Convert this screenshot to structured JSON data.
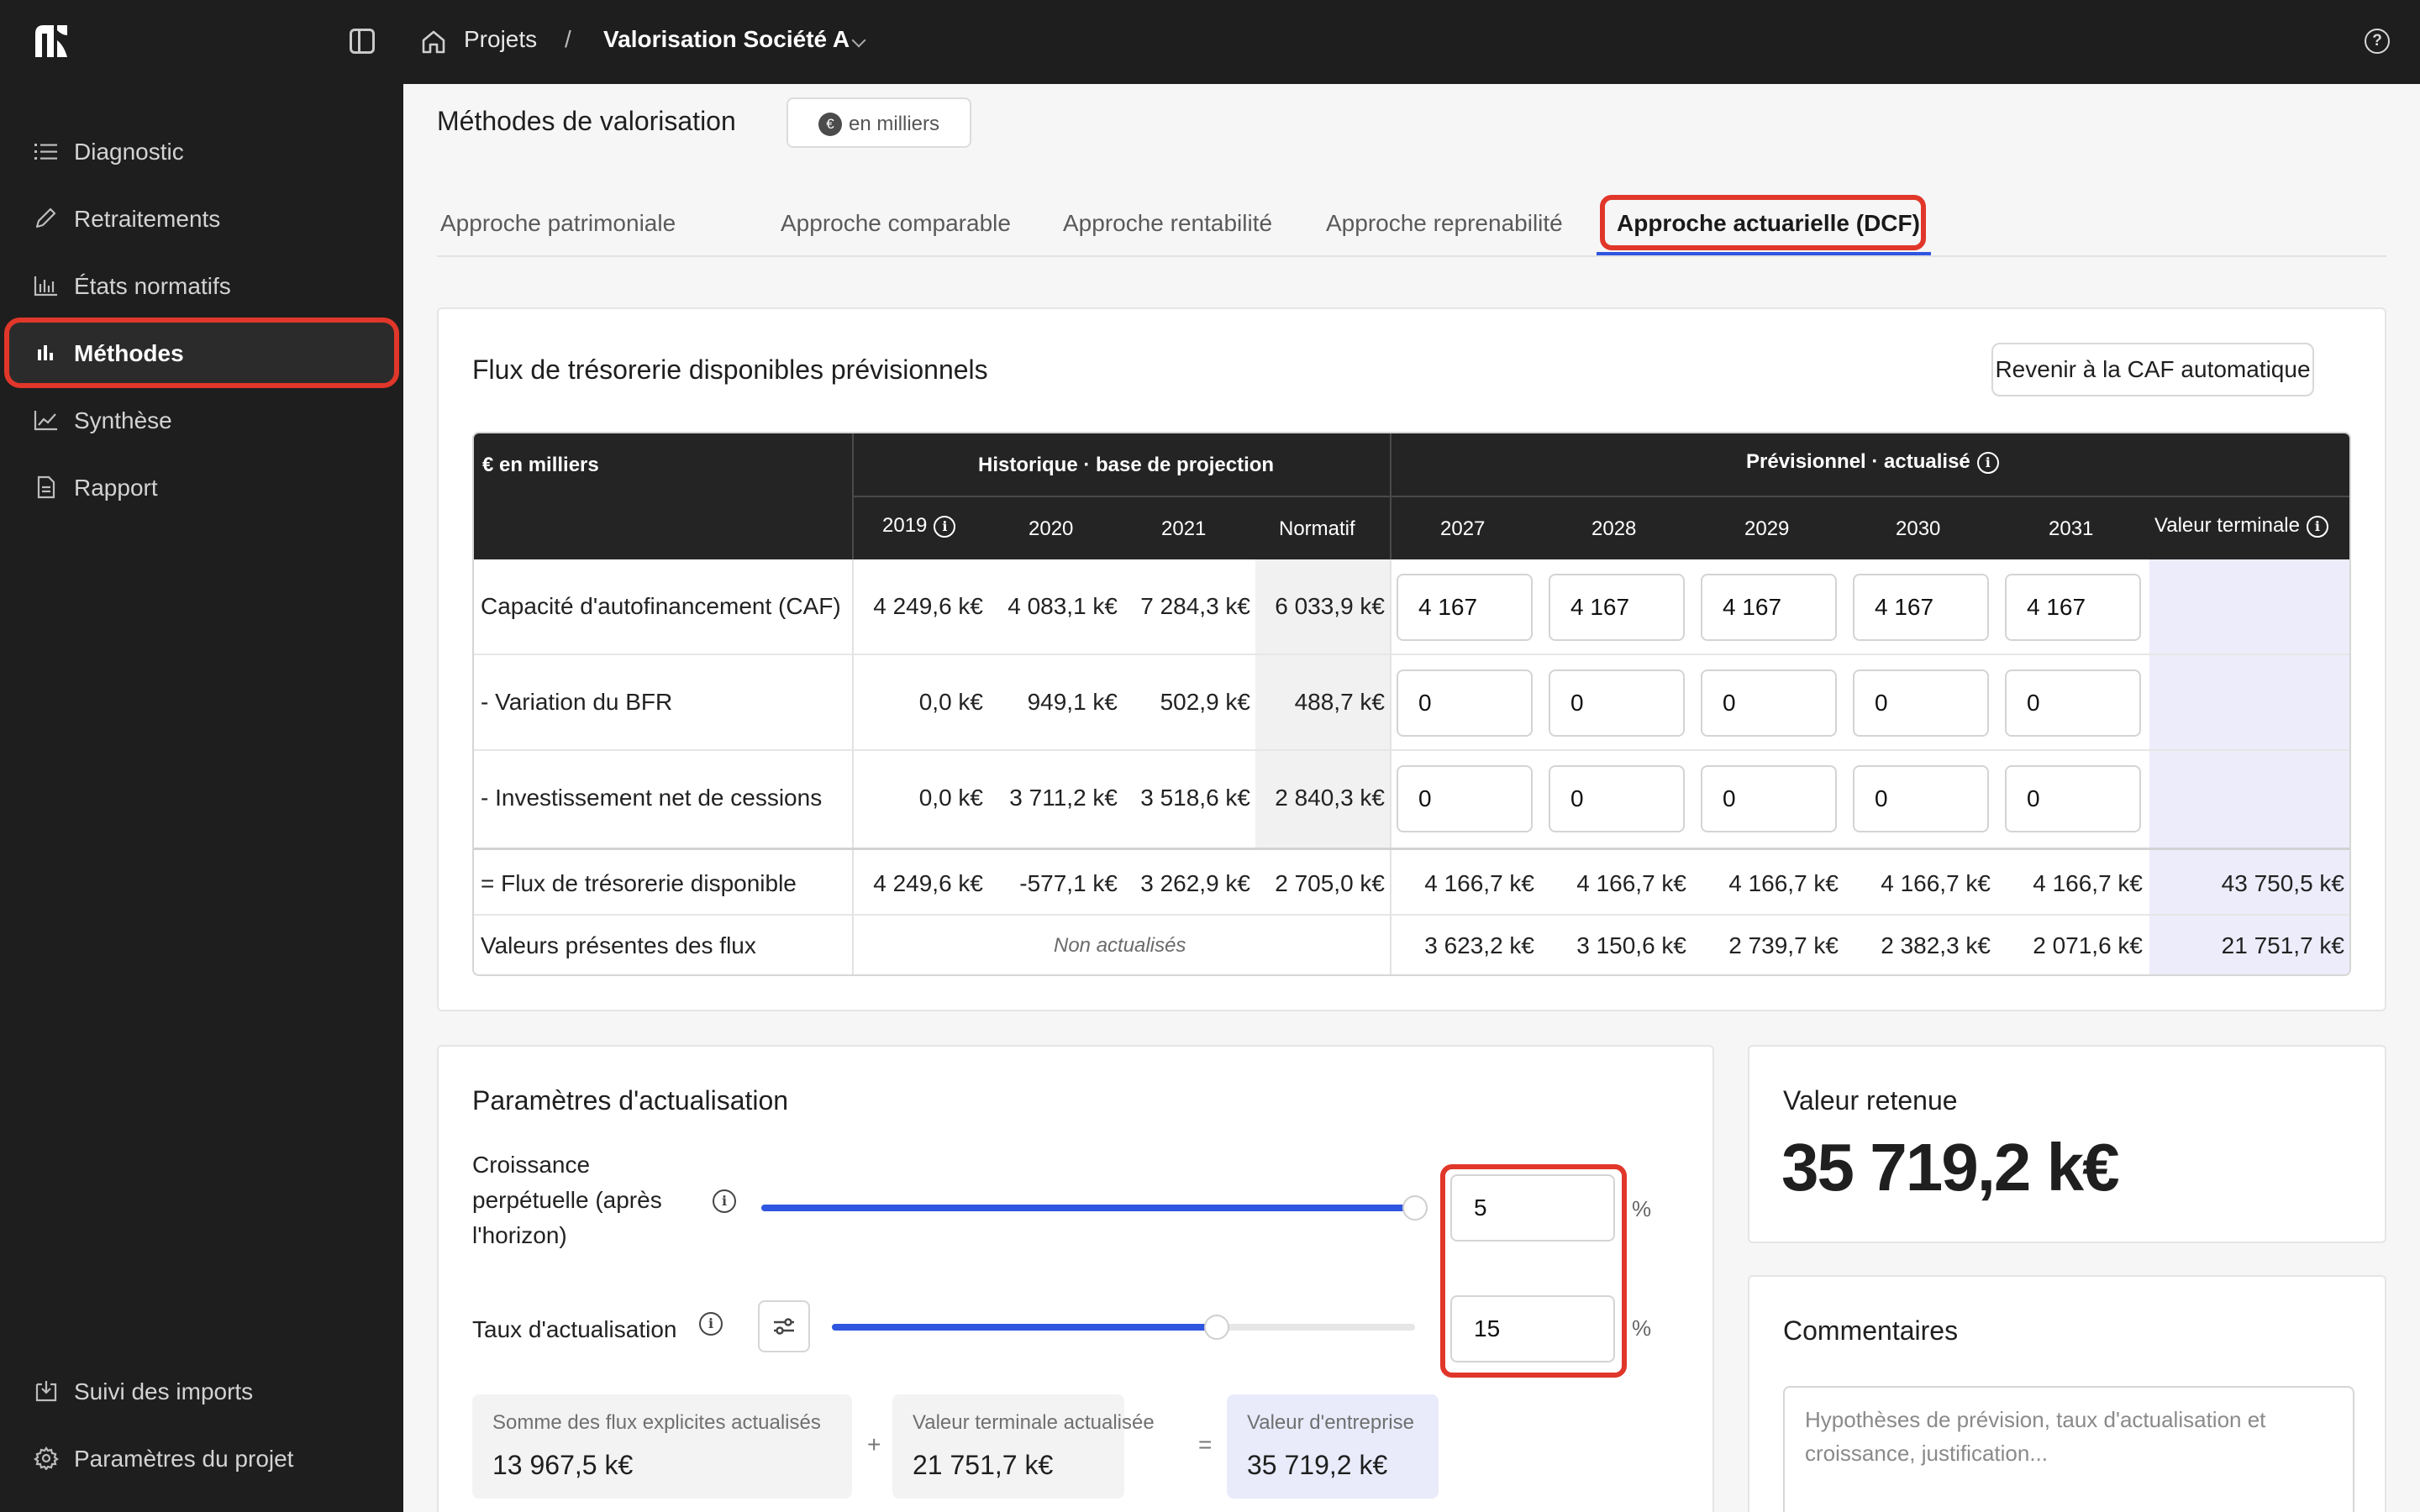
{
  "topbar": {
    "breadcrumb_root": "Projets",
    "breadcrumb_sep": "/",
    "breadcrumb_current": "Valorisation Société A"
  },
  "sidebar": {
    "items": [
      {
        "label": "Diagnostic",
        "icon": "list-icon"
      },
      {
        "label": "Retraitements",
        "icon": "pencil-icon"
      },
      {
        "label": "États normatifs",
        "icon": "bar-chart-icon"
      },
      {
        "label": "Méthodes",
        "icon": "bars-icon",
        "active": true
      },
      {
        "label": "Synthèse",
        "icon": "line-chart-icon"
      },
      {
        "label": "Rapport",
        "icon": "document-icon"
      }
    ],
    "bottom_items": [
      {
        "label": "Suivi des imports",
        "icon": "import-icon"
      },
      {
        "label": "Paramètres du projet",
        "icon": "gear-icon"
      }
    ]
  },
  "page": {
    "title": "Méthodes de valorisation",
    "unit_chip": "en milliers",
    "unit_symbol": "€"
  },
  "tabs": [
    "Approche patrimoniale",
    "Approche comparable",
    "Approche rentabilité",
    "Approche reprenabilité",
    "Approche actuarielle (DCF)"
  ],
  "active_tab": "Approche actuarielle (DCF)",
  "flux": {
    "title": "Flux de trésorerie disponibles prévisionnels",
    "revert_button": "Revenir à la CAF automatique",
    "table": {
      "corner": "€ en milliers",
      "group_hist": "Historique · base de projection",
      "group_prev": "Prévisionnel · actualisé",
      "hist_cols": [
        "2019",
        "2020",
        "2021",
        "Normatif"
      ],
      "prev_cols": [
        "2027",
        "2028",
        "2029",
        "2030",
        "2031"
      ],
      "terminal_col": "Valeur terminale",
      "rows": [
        {
          "label": "Capacité d'autofinancement (CAF)",
          "hist": [
            "4 249,6 k€",
            "4 083,1 k€",
            "7 284,3 k€",
            "6 033,9 k€"
          ],
          "inputs": [
            "4 167",
            "4 167",
            "4 167",
            "4 167",
            "4 167"
          ]
        },
        {
          "label": "- Variation du BFR",
          "hist": [
            "0,0 k€",
            "949,1 k€",
            "502,9 k€",
            "488,7 k€"
          ],
          "inputs": [
            "0",
            "0",
            "0",
            "0",
            "0"
          ]
        },
        {
          "label": "- Investissement net de cessions",
          "hist": [
            "0,0 k€",
            "3 711,2 k€",
            "3 518,6 k€",
            "2 840,3 k€"
          ],
          "inputs": [
            "0",
            "0",
            "0",
            "0",
            "0"
          ]
        }
      ],
      "fcf_row": {
        "label": "= Flux de trésorerie disponible",
        "hist": [
          "4 249,6 k€",
          "-577,1 k€",
          "3 262,9 k€",
          "2 705,0 k€"
        ],
        "prev": [
          "4 166,7 k€",
          "4 166,7 k€",
          "4 166,7 k€",
          "4 166,7 k€",
          "4 166,7 k€"
        ],
        "terminal": "43 750,5 k€"
      },
      "pv_row": {
        "label": "Valeurs présentes des flux",
        "note": "Non actualisés",
        "prev": [
          "3 623,2 k€",
          "3 150,6 k€",
          "2 739,7 k€",
          "2 382,3 k€",
          "2 071,6 k€"
        ],
        "terminal": "21 751,7 k€"
      }
    }
  },
  "params": {
    "title": "Paramètres d'actualisation",
    "growth_label": "Croissance perpétuelle (après l'horizon)",
    "growth_value": "5",
    "growth_slider_fraction": 1.0,
    "discount_label": "Taux d'actualisation",
    "discount_value": "15",
    "discount_slider_fraction": 0.66,
    "percent": "%",
    "sum_explicit_label": "Somme des flux explicites actualisés",
    "sum_explicit_value": "13 967,5 k€",
    "terminal_label": "Valeur terminale actualisée",
    "terminal_value": "21 751,7 k€",
    "ev_label": "Valeur d'entreprise",
    "ev_value": "35 719,2 k€",
    "plus": "+",
    "equals": "="
  },
  "retained": {
    "title": "Valeur retenue",
    "value": "35 719,2 k€"
  },
  "comments": {
    "title": "Commentaires",
    "placeholder": "Hypothèses de prévision, taux d'actualisation et croissance, justification..."
  },
  "colors": {
    "accent": "#2f56e0",
    "highlight": "#e0372a",
    "dark": "#1e1e1e",
    "terminal_bg": "#ececfb"
  }
}
